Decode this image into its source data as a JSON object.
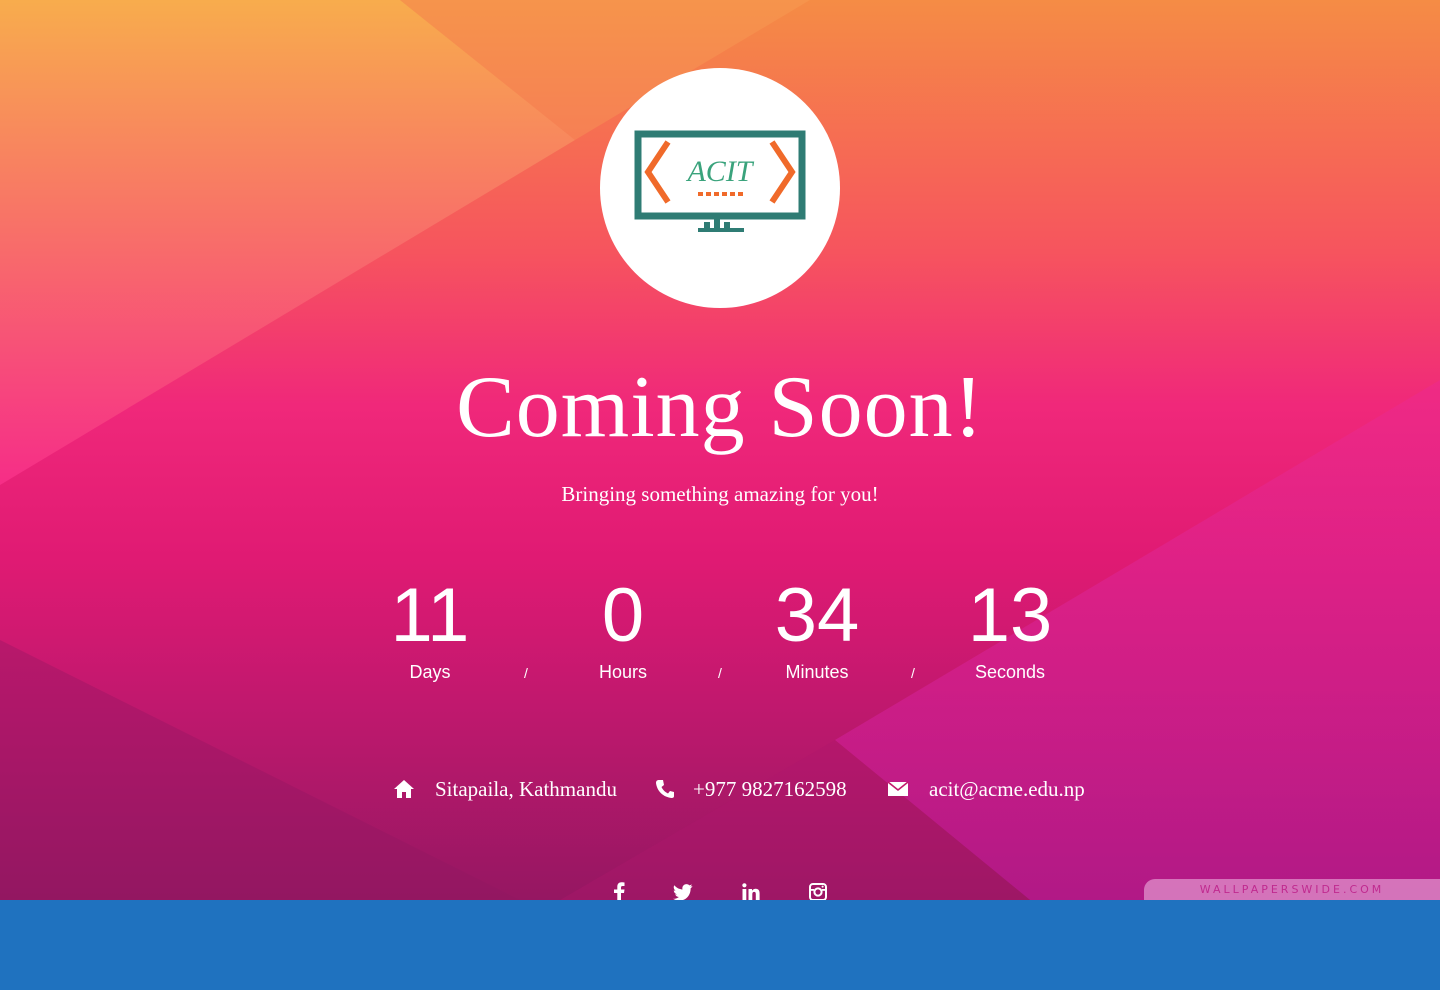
{
  "logo": {
    "text": "ACIT",
    "primary_color": "#2f7c74",
    "accent_color": "#f06a2a"
  },
  "title": "Coming Soon!",
  "subtitle": "Bringing something amazing for you!",
  "countdown": [
    {
      "value": "11",
      "label": "Days"
    },
    {
      "value": "0",
      "label": "Hours"
    },
    {
      "value": "34",
      "label": "Minutes"
    },
    {
      "value": "13",
      "label": "Seconds"
    }
  ],
  "separator": "/",
  "contact": {
    "address": "Sitapaila, Kathmandu",
    "phone": "+977 9827162598",
    "email": "acit@acme.edu.np"
  },
  "social": [
    "facebook-icon",
    "twitter-icon",
    "linkedin-icon",
    "instagram-icon"
  ],
  "watermark": "wallpaperswide.com",
  "colors": {
    "footer": "#1f72bf",
    "text": "#ffffff"
  }
}
